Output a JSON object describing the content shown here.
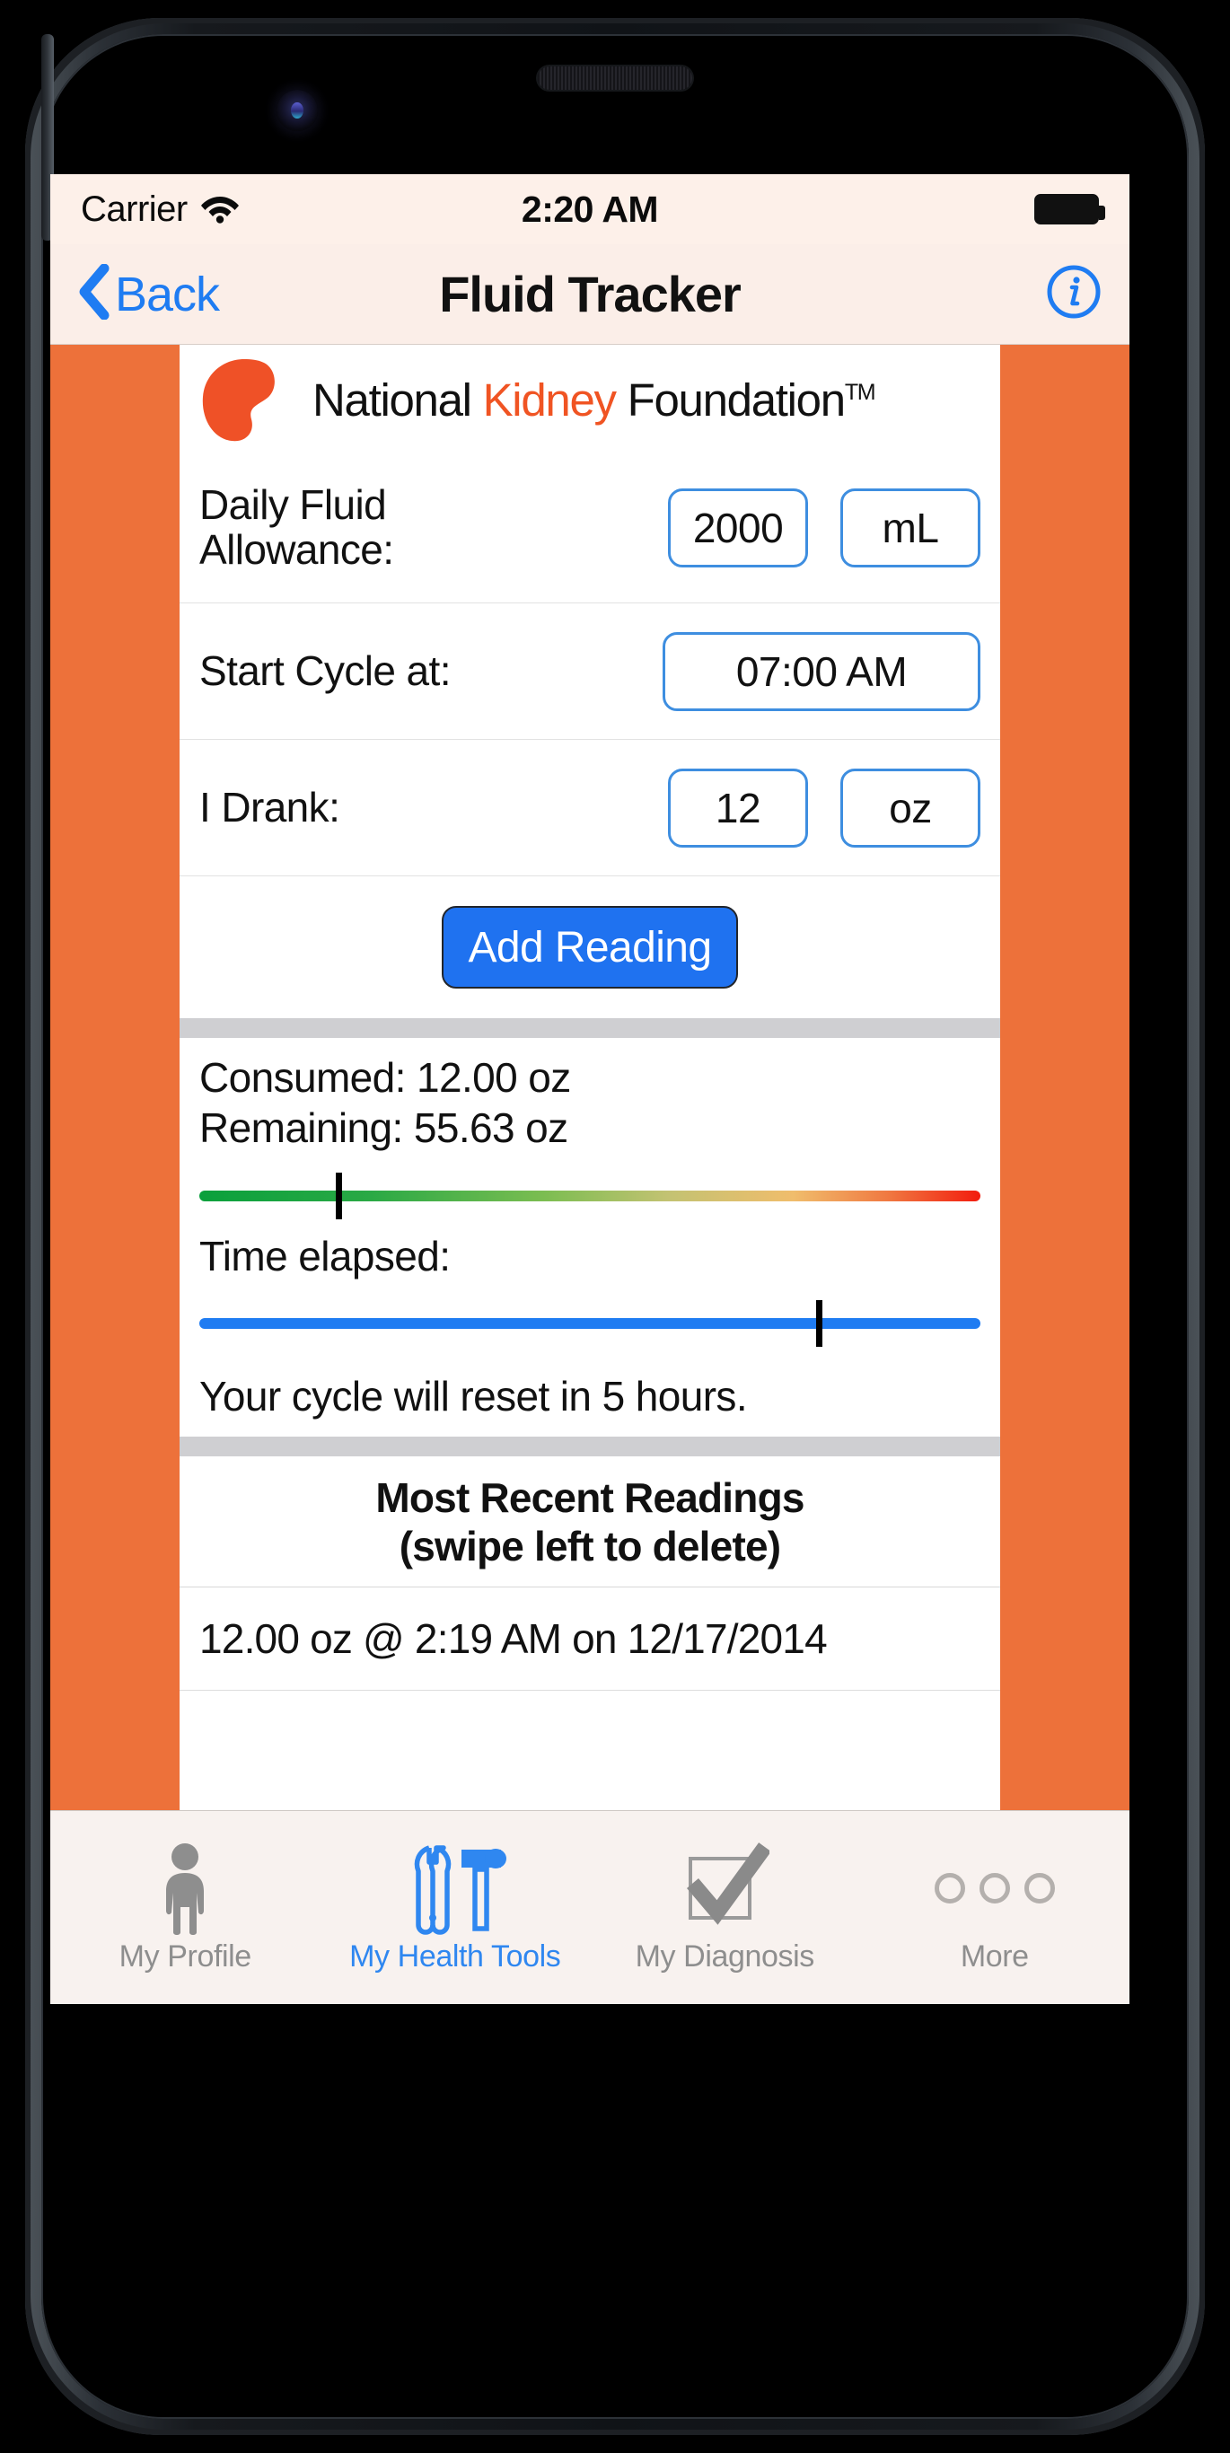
{
  "statusbar": {
    "carrier": "Carrier",
    "time": "2:20 AM",
    "wifi_icon": "wifi-icon",
    "battery_icon": "battery-full-icon"
  },
  "navbar": {
    "back_label": "Back",
    "back_icon": "chevron-left-icon",
    "title": "Fluid Tracker",
    "info_icon": "info-circle-icon"
  },
  "branding": {
    "logo_icon": "kidney-logo-icon",
    "word1": "National ",
    "word_highlight": "Kidney",
    "word2": " Foundation",
    "trademark": "TM",
    "highlight_color": "#f05423",
    "accent_color": "#ED713A"
  },
  "form": {
    "allowance": {
      "label_line1": "Daily Fluid",
      "label_line2": "Allowance:",
      "value": "2000",
      "unit": "mL"
    },
    "start_cycle": {
      "label": "Start Cycle at:",
      "value": "07:00 AM"
    },
    "drank": {
      "label": "I Drank:",
      "value": "12",
      "unit": "oz"
    },
    "add_button": "Add Reading"
  },
  "stats": {
    "consumed": "Consumed: 12.00 oz",
    "remaining": "Remaining: 55.63 oz",
    "time_elapsed_label": "Time elapsed:",
    "reset_note": "Your cycle will reset in 5 hours.",
    "consumed_marker_pct": 17.5,
    "time_marker_pct": 79
  },
  "readings": {
    "heading_line1": "Most Recent Readings",
    "heading_line2": "(swipe left to delete)",
    "items": [
      "12.00 oz @ 2:19 AM on 12/17/2014"
    ]
  },
  "tabbar": {
    "tabs": [
      {
        "label": "My Profile",
        "icon": "person-icon",
        "active": false
      },
      {
        "label": "My Health Tools",
        "icon": "tools-icon",
        "active": true
      },
      {
        "label": "My Diagnosis",
        "icon": "checkbox-check-icon",
        "active": false
      },
      {
        "label": "More",
        "icon": "more-dots-icon",
        "active": false
      }
    ]
  }
}
